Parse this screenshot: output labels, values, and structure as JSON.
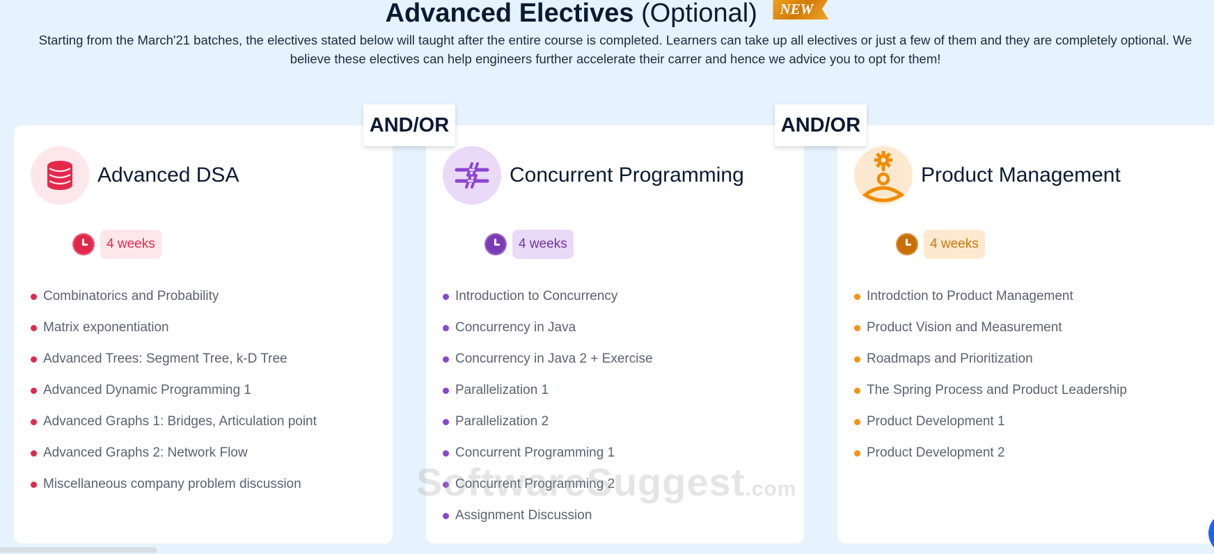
{
  "header": {
    "title_strong": "Advanced Electives",
    "title_light": "(Optional)",
    "new_badge": "NEW",
    "description": "Starting from the March'21 batches, the electives stated below will taught after the entire course is completed. Learners can take up all electives or just a few of them and they are completely optional. We believe these electives can help engineers further accelerate their carrer and hence we advice you to opt for them!"
  },
  "connectors": [
    "AND/OR",
    "AND/OR"
  ],
  "electives": [
    {
      "title": "Advanced DSA",
      "icon": "database-icon",
      "duration": "4 weeks",
      "colors": {
        "accent": "#e2294c",
        "icon_bg": "#fde7ea",
        "badge_bg": "#fde7ea",
        "badge_text": "#e2294c",
        "bullet": "#e2294c"
      },
      "topics": [
        "Combinatorics and Probability",
        "Matrix exponentiation",
        "Advanced Trees: Segment Tree, k-D Tree",
        "Advanced Dynamic Programming 1",
        "Advanced Graphs 1: Bridges, Articulation point",
        "Advanced Graphs 2: Network Flow",
        "Miscellaneous company problem discussion"
      ]
    },
    {
      "title": "Concurrent Programming",
      "icon": "parallel-lines-icon",
      "duration": "4 weeks",
      "colors": {
        "accent": "#7b3bb5",
        "icon_bg": "#ead9f7",
        "badge_bg": "#ead9f7",
        "badge_text": "#6f35a8",
        "bullet": "#8c45d0"
      },
      "topics": [
        "Introduction to Concurrency",
        "Concurrency in Java",
        "Concurrency in Java 2 + Exercise",
        "Parallelization 1",
        "Parallelization 2",
        "Concurrent Programming 1",
        "Concurrent Programming 2",
        "Assignment Discussion"
      ]
    },
    {
      "title": "Product Management",
      "icon": "product-manager-icon",
      "duration": "4 weeks",
      "colors": {
        "accent": "#f08c00",
        "icon_bg": "#fde9d0",
        "badge_bg": "#fde9d0",
        "badge_text": "#c9770e",
        "bullet": "#f59312",
        "clock": "#c76f00"
      },
      "topics": [
        "Introdction to Product Management",
        "Product Vision and Measurement",
        "Roadmaps and Prioritization",
        "The Spring Process and Product Leadership",
        "Product Development 1",
        "Product Development 2"
      ]
    }
  ],
  "watermark": {
    "main": "SoftwareSuggest",
    "suffix": ".com"
  }
}
